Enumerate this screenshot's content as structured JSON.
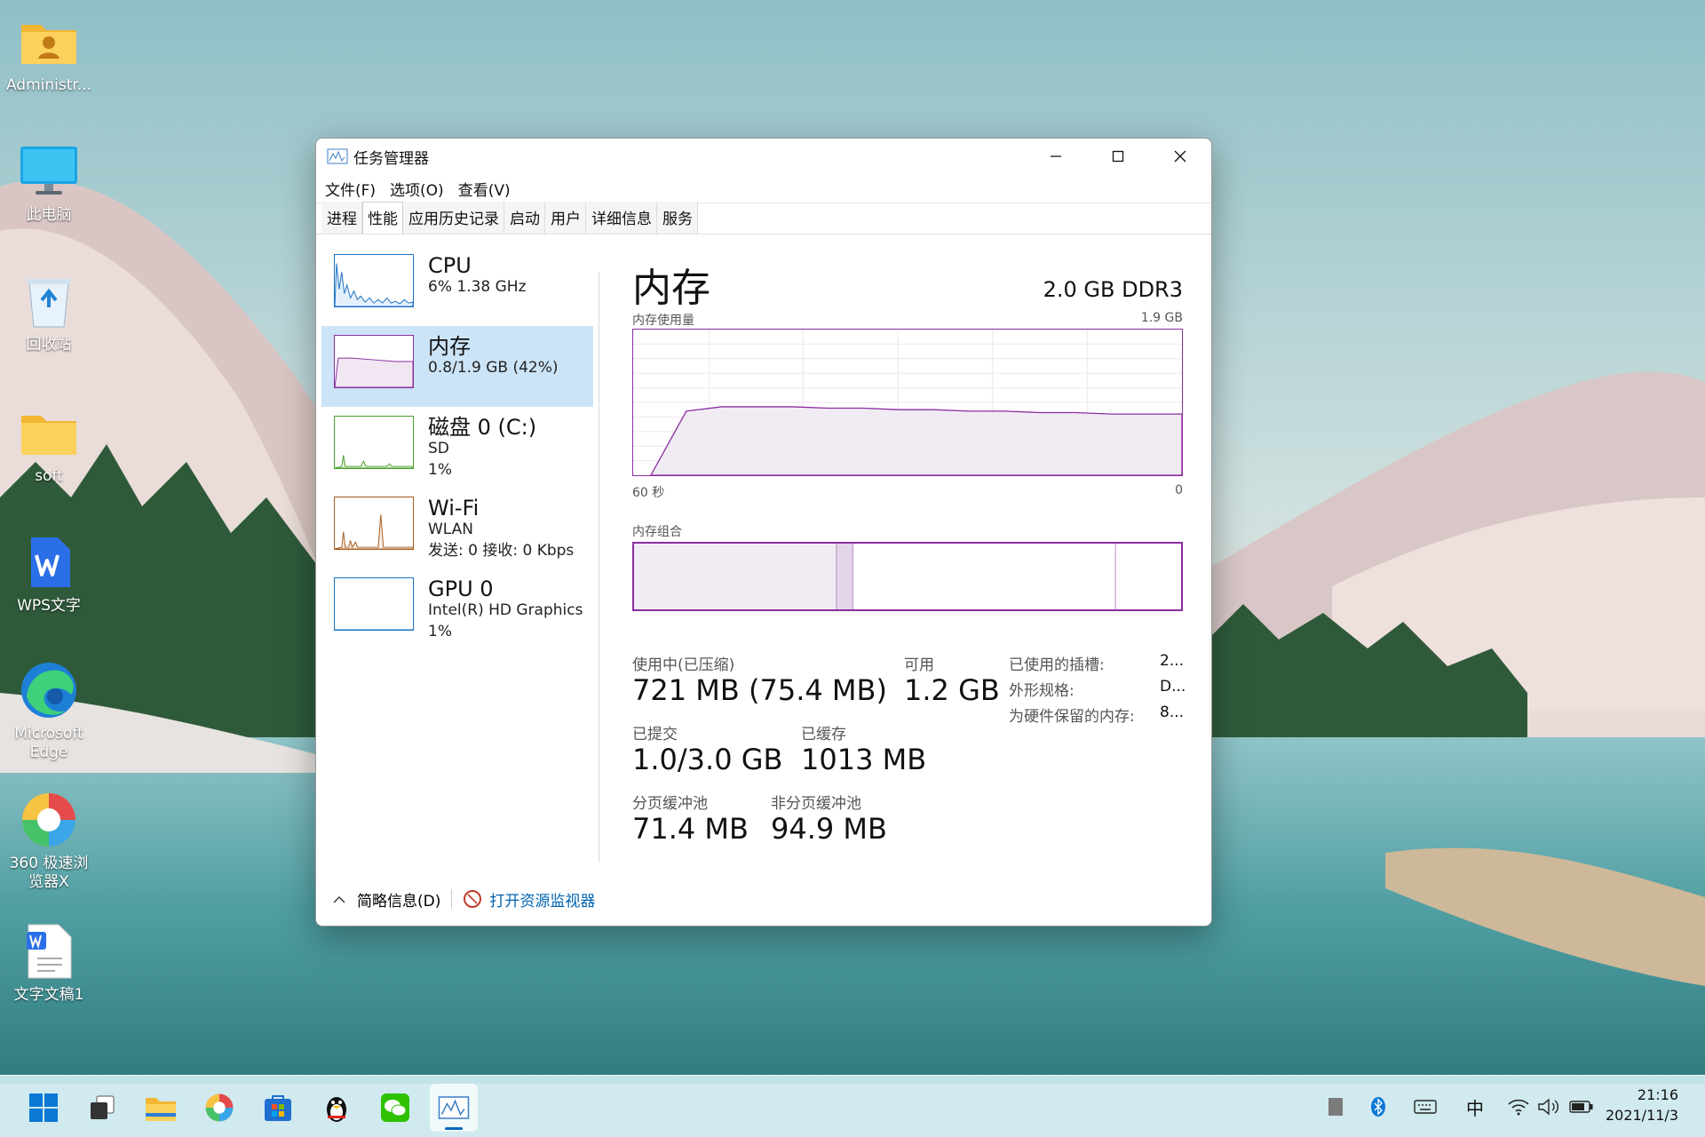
{
  "desktop": {
    "icons": [
      {
        "label": "Administr..."
      },
      {
        "label": "此电脑"
      },
      {
        "label": "回收站"
      },
      {
        "label": "soft"
      },
      {
        "label": "WPS文字"
      },
      {
        "label": "Microsoft Edge"
      },
      {
        "label": "360 极速浏览器X"
      },
      {
        "label": "文字文稿1"
      }
    ]
  },
  "window": {
    "title": "任务管理器",
    "menu": [
      "文件(F)",
      "选项(O)",
      "查看(V)"
    ],
    "tabs": [
      "进程",
      "性能",
      "应用历史记录",
      "启动",
      "用户",
      "详细信息",
      "服务"
    ],
    "active_tab": "性能"
  },
  "sidebar": {
    "items": [
      {
        "name": "CPU",
        "line1": "6%  1.38 GHz",
        "line2": "",
        "color": "#1a73c5"
      },
      {
        "name": "内存",
        "line1": "0.8/1.9 GB (42%)",
        "line2": "",
        "color": "#8b2da0"
      },
      {
        "name": "磁盘 0 (C:)",
        "line1": "SD",
        "line2": "1%",
        "color": "#4aa02c"
      },
      {
        "name": "Wi-Fi",
        "line1": "WLAN",
        "line2": "发送: 0  接收: 0 Kbps",
        "color": "#a75c1e"
      },
      {
        "name": "GPU 0",
        "line1": "Intel(R) HD Graphics",
        "line2": "1%",
        "color": "#1a73c5"
      }
    ]
  },
  "memory": {
    "title": "内存",
    "spec": "2.0 GB DDR3",
    "usage_label": "内存使用量",
    "usage_max": "1.9 GB",
    "time_left": "60 秒",
    "time_right": "0",
    "composition_label": "内存组合",
    "composition": {
      "in_use_fraction": 0.37,
      "modified_fraction": 0.03,
      "standby_fraction": 0.48
    },
    "usage_history_percent": [
      0,
      44,
      47,
      47,
      47,
      46,
      46,
      45,
      45,
      44,
      44,
      43,
      43,
      42,
      42,
      42
    ],
    "stats": {
      "in_use_label": "使用中(已压缩)",
      "in_use_value": "721 MB (75.4 MB)",
      "available_label": "可用",
      "available_value": "1.2 GB",
      "committed_label": "已提交",
      "committed_value": "1.0/3.0 GB",
      "cached_label": "已缓存",
      "cached_value": "1013 MB",
      "paged_label": "分页缓冲池",
      "paged_value": "71.4 MB",
      "nonpaged_label": "非分页缓冲池",
      "nonpaged_value": "94.9 MB"
    },
    "info": {
      "slots_label": "已使用的插槽:",
      "slots_value": "2...",
      "form_label": "外形规格:",
      "form_value": "D...",
      "reserved_label": "为硬件保留的内存:",
      "reserved_value": "8..."
    }
  },
  "footer": {
    "summary_label": "简略信息(D)",
    "monitor_link": "打开资源监视器"
  },
  "taskbar": {
    "ime": "中",
    "time": "21:16",
    "date": "2021/11/3"
  }
}
